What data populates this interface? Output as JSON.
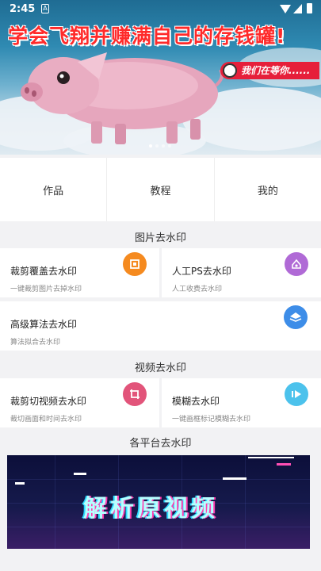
{
  "status_bar": {
    "time": "2:45",
    "notification_glyph": "A"
  },
  "banner": {
    "title": "学会飞翔并赚满自己的存钱罐!",
    "tag_text": "我们在等你......",
    "page_indicator": {
      "count": 4,
      "active": 0
    }
  },
  "tabs": [
    {
      "label": "作品"
    },
    {
      "label": "教程"
    },
    {
      "label": "我的"
    }
  ],
  "sections": {
    "image": {
      "title": "图片去水印",
      "cards": [
        {
          "title": "裁剪覆盖去水印",
          "subtitle": "一键裁剪图片去掉水印",
          "icon": "crop-square-icon",
          "color": "#f58a1f"
        },
        {
          "title": "人工PS去水印",
          "subtitle": "人工收费去水印",
          "icon": "manual-edit-icon",
          "color": "#b06ad6"
        },
        {
          "title": "高级算法去水印",
          "subtitle": "算法拟合去水印",
          "icon": "layers-icon",
          "color": "#3d8de8"
        }
      ]
    },
    "video": {
      "title": "视频去水印",
      "cards": [
        {
          "title": "裁剪切视频去水印",
          "subtitle": "裁切画面和时间去水印",
          "icon": "crop-icon",
          "color": "#e2547a"
        },
        {
          "title": "模糊去水印",
          "subtitle": "一键画框标记模糊去水印",
          "icon": "blur-play-icon",
          "color": "#4cc2ec"
        }
      ]
    },
    "platform": {
      "title": "各平台去水印",
      "banner_text": "解析原视频"
    }
  }
}
